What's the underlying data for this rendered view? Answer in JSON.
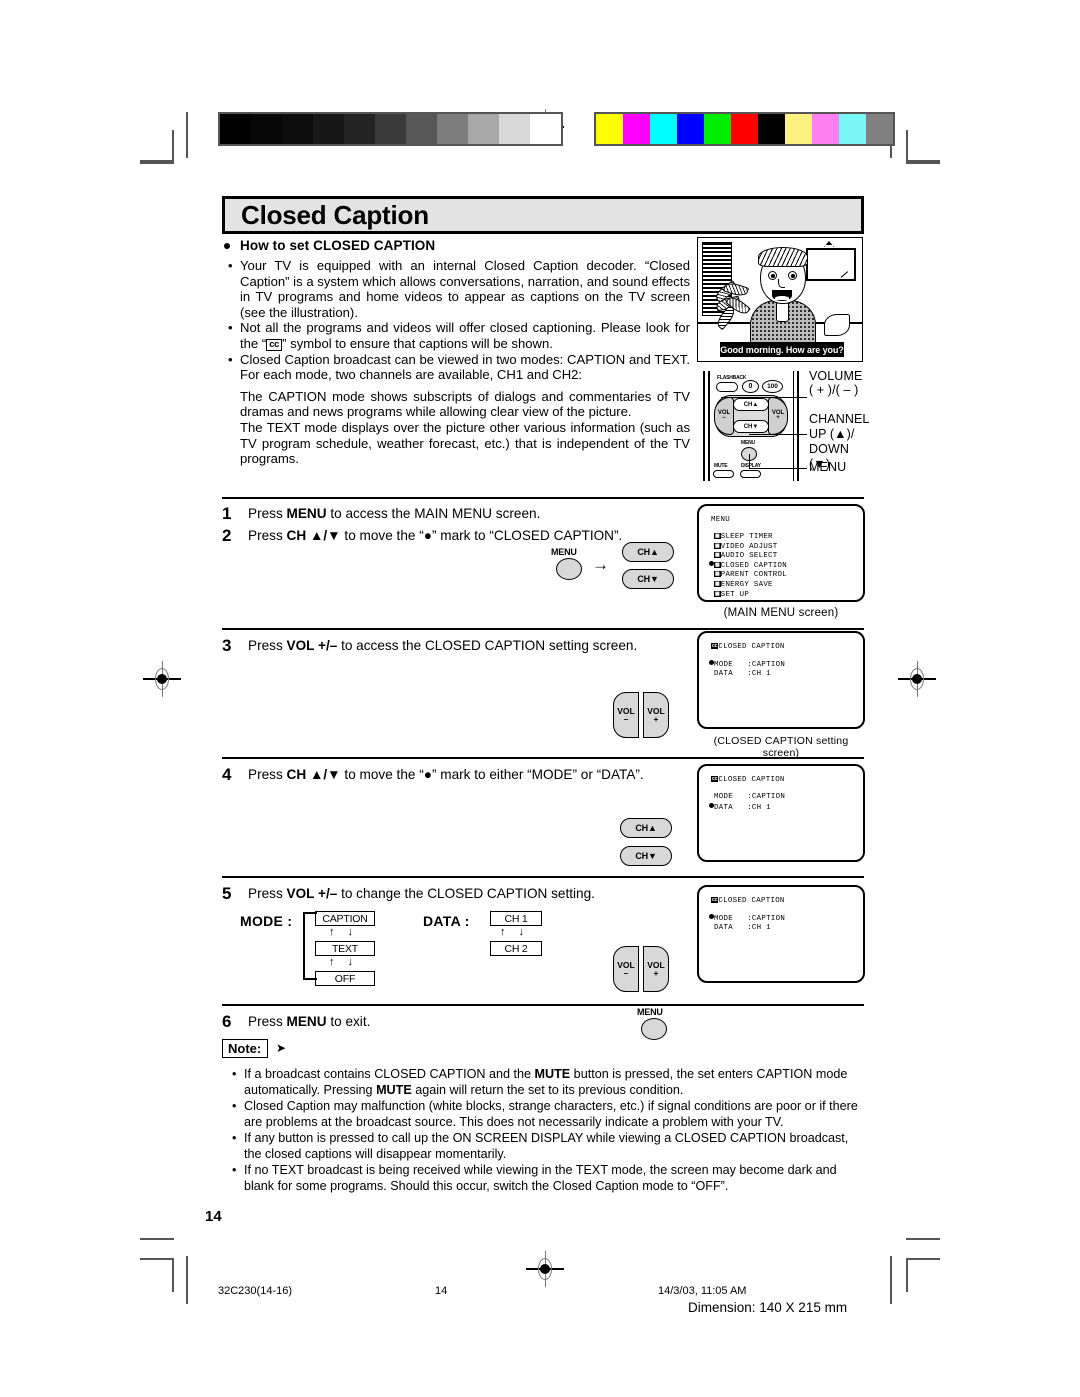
{
  "document": {
    "title": "Closed Caption",
    "page_number": "14"
  },
  "section": {
    "heading": "How to set CLOSED CAPTION",
    "bullets": [
      "Your TV is equipped with an internal Closed Caption decoder. “Closed Caption” is a system which allows conversations, narration, and sound effects in TV programs and home videos to appear as captions on the TV screen (see the illustration).",
      "Not all the programs and videos will offer closed captioning. Please look for the “",
      "Closed Caption broadcast can be viewed in two modes: CAPTION and TEXT. For each mode, two channels are available, CH1 and CH2:"
    ],
    "bullet2_suffix": "” symbol to ensure that captions will be shown.",
    "cc_symbol": "cc",
    "paragraphs": [
      "The CAPTION mode shows subscripts of dialogs and commentaries of TV dramas and news programs while allowing clear view of the picture.",
      "The TEXT mode displays over the picture other various information (such as TV program schedule, weather forecast, etc.) that is independent of the TV programs."
    ]
  },
  "illustration": {
    "caption_text": "Good morning. How are you?"
  },
  "remote": {
    "buttons": {
      "flashback": "FLASHBACK",
      "zero": "0",
      "hundred": "100",
      "vol_minus": "VOL",
      "vol_minus_sign": "–",
      "vol_plus": "VOL",
      "vol_plus_sign": "+",
      "ch_up": "CH▲",
      "ch_down": "CH▼",
      "menu": "MENU",
      "mute": "MUTE",
      "display": "DISPLAY"
    },
    "callouts": {
      "volume_l1": "VOLUME",
      "volume_l2": "( + )/( – )",
      "channel_l1": "CHANNEL",
      "channel_l2": "UP (▲)/",
      "channel_l3": "DOWN (▼)",
      "menu": "MENU"
    }
  },
  "steps": [
    {
      "num": "1",
      "pre": "Press ",
      "bold": "MENU",
      "post": " to access the MAIN MENU screen."
    },
    {
      "num": "2",
      "pre": "Press ",
      "bold": "CH ▲/▼",
      "post": " to move the “●” mark to “CLOSED CAPTION”."
    },
    {
      "num": "3",
      "pre": "Press ",
      "bold": "VOL +/–",
      "post": " to access the CLOSED CAPTION setting screen."
    },
    {
      "num": "4",
      "pre": "Press ",
      "bold": "CH ▲/▼",
      "post": " to move the “●” mark to either “MODE” or “DATA”."
    },
    {
      "num": "5",
      "pre": "Press ",
      "bold": "VOL +/–",
      "post": " to change the CLOSED CAPTION setting."
    },
    {
      "num": "6",
      "pre": "Press ",
      "bold": "MENU",
      "post": " to exit."
    }
  ],
  "step_controls": {
    "menu_label": "MENU",
    "ch_up": "CH▲",
    "ch_down": "CH▼",
    "arrow": "→",
    "vol_label": "VOL",
    "vol_minus": "–",
    "vol_plus": "+"
  },
  "main_menu_screen": {
    "title": "MENU",
    "caption": "(MAIN  MENU  screen)",
    "items": [
      {
        "label": "SLEEP TIMER",
        "selected": false
      },
      {
        "label": "VIDEO ADJUST",
        "selected": false
      },
      {
        "label": "AUDIO SELECT",
        "selected": false
      },
      {
        "label": "CLOSED CAPTION",
        "selected": true
      },
      {
        "label": "PARENT CONTROL",
        "selected": false
      },
      {
        "label": "ENERGY SAVE",
        "selected": false
      },
      {
        "label": "SET UP",
        "selected": false
      }
    ]
  },
  "cc_screens": {
    "caption": "(CLOSED CAPTION setting screen)",
    "header": "CLOSED CAPTION",
    "screen3": {
      "mode_label": "MODE",
      "mode_value": ":CAPTION",
      "data_label": "DATA",
      "data_value": ":CH 1",
      "marked": "MODE"
    },
    "screen4": {
      "mode_label": "MODE",
      "mode_value": ":CAPTION",
      "data_label": "DATA",
      "data_value": ":CH 1",
      "marked": "DATA"
    },
    "screen5": {
      "mode_label": "MODE",
      "mode_value": ":CAPTION",
      "data_label": "DATA",
      "data_value": ":CH 1",
      "marked": "MODE"
    }
  },
  "setting_flow": {
    "mode_label": "MODE :",
    "mode_values": [
      "CAPTION",
      "TEXT",
      "OFF"
    ],
    "data_label": "DATA :",
    "data_values": [
      "CH 1",
      "CH 2"
    ],
    "arrows": "↑  ↓"
  },
  "note": {
    "label": "Note:",
    "arrow": "➤",
    "items": [
      {
        "a": "If a broadcast contains CLOSED CAPTION and the ",
        "b": "MUTE",
        "c": " button is pressed, the set enters CAPTION mode automatically. Pressing ",
        "d": "MUTE",
        "e": " again will return the set to its previous condition."
      },
      {
        "a": "Closed Caption may malfunction (white blocks, strange characters, etc.) if signal conditions are poor or if there are problems at the broadcast source. This does not necessarily indicate a problem with your TV."
      },
      {
        "a": "If any button is pressed to call up the ON SCREEN DISPLAY while viewing a CLOSED CAPTION broadcast, the closed captions will disappear momentarily."
      },
      {
        "a": "If no TEXT broadcast is being received while viewing in the TEXT mode, the screen may become dark and blank for some programs. Should this occur, switch the Closed Caption mode to “OFF”."
      }
    ]
  },
  "footer": {
    "doc_code": "32C230(14-16)",
    "page": "14",
    "timestamp": "14/3/03, 11:05 AM",
    "dimension": "Dimension: 140  X 215 mm"
  },
  "calibration": {
    "grayscale": [
      "#000000",
      "#060606",
      "#0c0c0c",
      "#171717",
      "#232323",
      "#3a3a3a",
      "#575757",
      "#7d7d7d",
      "#a8a8a8",
      "#d8d8d8",
      "#ffffff"
    ],
    "colors": [
      "#ffff00",
      "#ff00ff",
      "#00ffff",
      "#0000ff",
      "#00ee00",
      "#ff0000",
      "#000000",
      "#fdf281",
      "#ff80f0",
      "#7bf6f6",
      "#808080"
    ]
  }
}
